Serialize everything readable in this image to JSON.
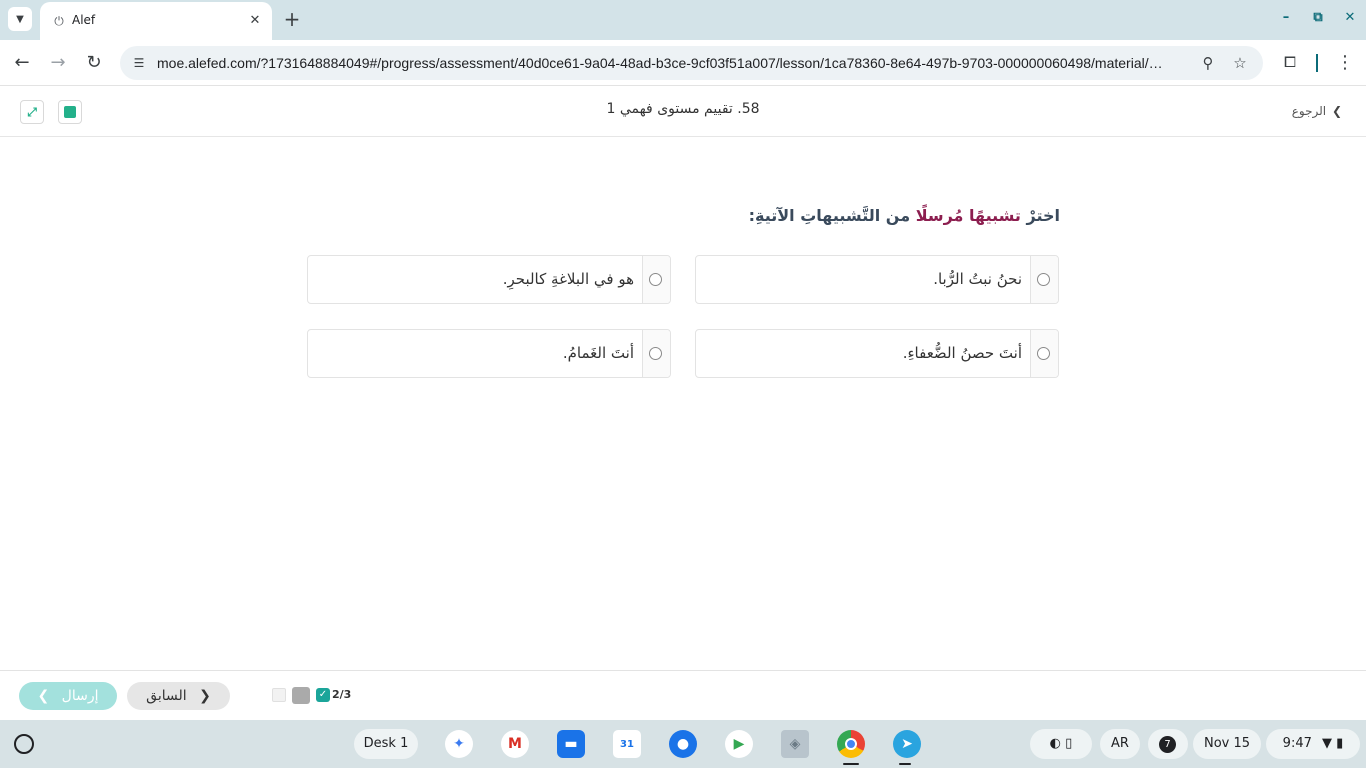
{
  "browser": {
    "tab_title": "Alef",
    "url": "moe.alefed.com/?1731648884049#/progress/assessment/40d0ce61-9a04-48ad-b3ce-9cf03f51a007/lesson/1ca78360-8e64-497b-9703-000000060498/material/…",
    "icons": {
      "tab_search": "chevron-down-icon",
      "favicon": "alef-favicon-icon",
      "close": "close-icon",
      "new_tab": "plus-icon",
      "back": "arrow-left-icon",
      "forward": "arrow-right-icon",
      "reload": "reload-icon",
      "site_info": "tune-icon",
      "zoom": "zoom-icon",
      "bookmark": "star-icon",
      "extensions": "puzzle-icon",
      "menu": "more-vert-icon"
    }
  },
  "app": {
    "title": "58. تقييم مستوى فهمي 1",
    "back_label": "الرجوع",
    "question": {
      "prefix": "اخترْ ",
      "highlight": "تشبيهًا مُرسلًا",
      "suffix": " من التَّشبيهاتِ الآتيةِ:"
    },
    "options": [
      "نحنُ نبتُ الرُّبا.",
      "هو في البلاغةِ كالبحرِ.",
      "أنتَ حصنُ الضُّعفاءِ.",
      "أنتَ الغَمامُ."
    ],
    "footer": {
      "submit_label": "إرسال",
      "prev_label": "السابق",
      "progress_count": "2/3"
    },
    "colors": {
      "accent": "#23b08a",
      "highlight": "#8c1e4f",
      "submit_bg": "#a3e1dd"
    }
  },
  "shelf": {
    "desk_label": "Desk 1",
    "lang": "AR",
    "notification_count": "7",
    "date": "Nov 15",
    "time": "9:47",
    "calendar_day": "31",
    "apps": [
      "gemini",
      "gmail",
      "files",
      "calendar",
      "chat",
      "play-store",
      "generic-app",
      "chrome",
      "telegram"
    ]
  }
}
